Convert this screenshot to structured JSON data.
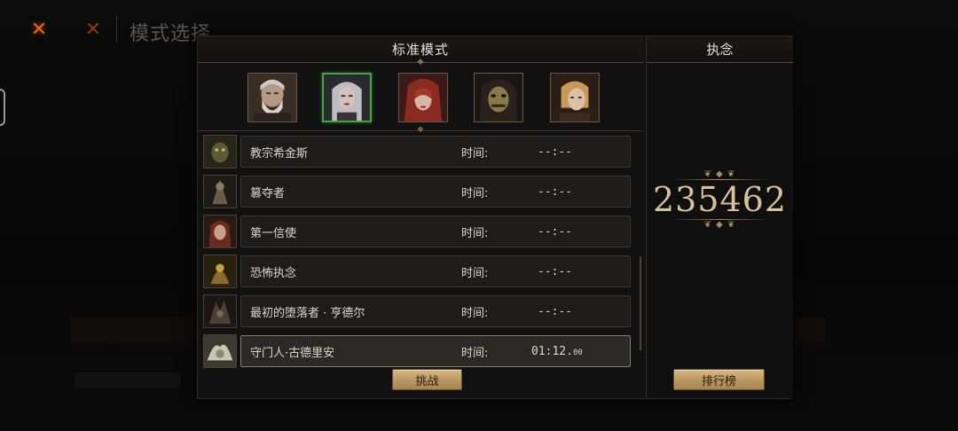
{
  "background": {
    "title": "模式选择"
  },
  "panel": {
    "mode_title": "标准模式",
    "side_title": "执念",
    "score": "235462",
    "challenge_label": "挑战",
    "leaderboard_label": "排行榜"
  },
  "portraits": [
    {
      "name": "old-bearded-man",
      "selected": false
    },
    {
      "name": "silver-haired-woman",
      "selected": true
    },
    {
      "name": "red-hooded-woman",
      "selected": false
    },
    {
      "name": "masked-hooded-figure",
      "selected": false
    },
    {
      "name": "blond-youth",
      "selected": false
    }
  ],
  "bosses": [
    {
      "name": "教宗希金斯",
      "time_label": "时间:",
      "time": "--:--",
      "time_ms": ""
    },
    {
      "name": "篡夺者",
      "time_label": "时间:",
      "time": "--:--",
      "time_ms": ""
    },
    {
      "name": "第一信使",
      "time_label": "时间:",
      "time": "--:--",
      "time_ms": ""
    },
    {
      "name": "恐怖执念",
      "time_label": "时间:",
      "time": "--:--",
      "time_ms": ""
    },
    {
      "name": "最初的堕落者 · 亨德尔",
      "time_label": "时间:",
      "time": "--:--",
      "time_ms": ""
    },
    {
      "name": "守门人·古德里安",
      "time_label": "时间:",
      "time": "01:12.",
      "time_ms": "00"
    }
  ],
  "colors": {
    "accent_gold": "#d9c29a",
    "selected_border": "#48a048",
    "button_gold": "#c4a46e"
  }
}
